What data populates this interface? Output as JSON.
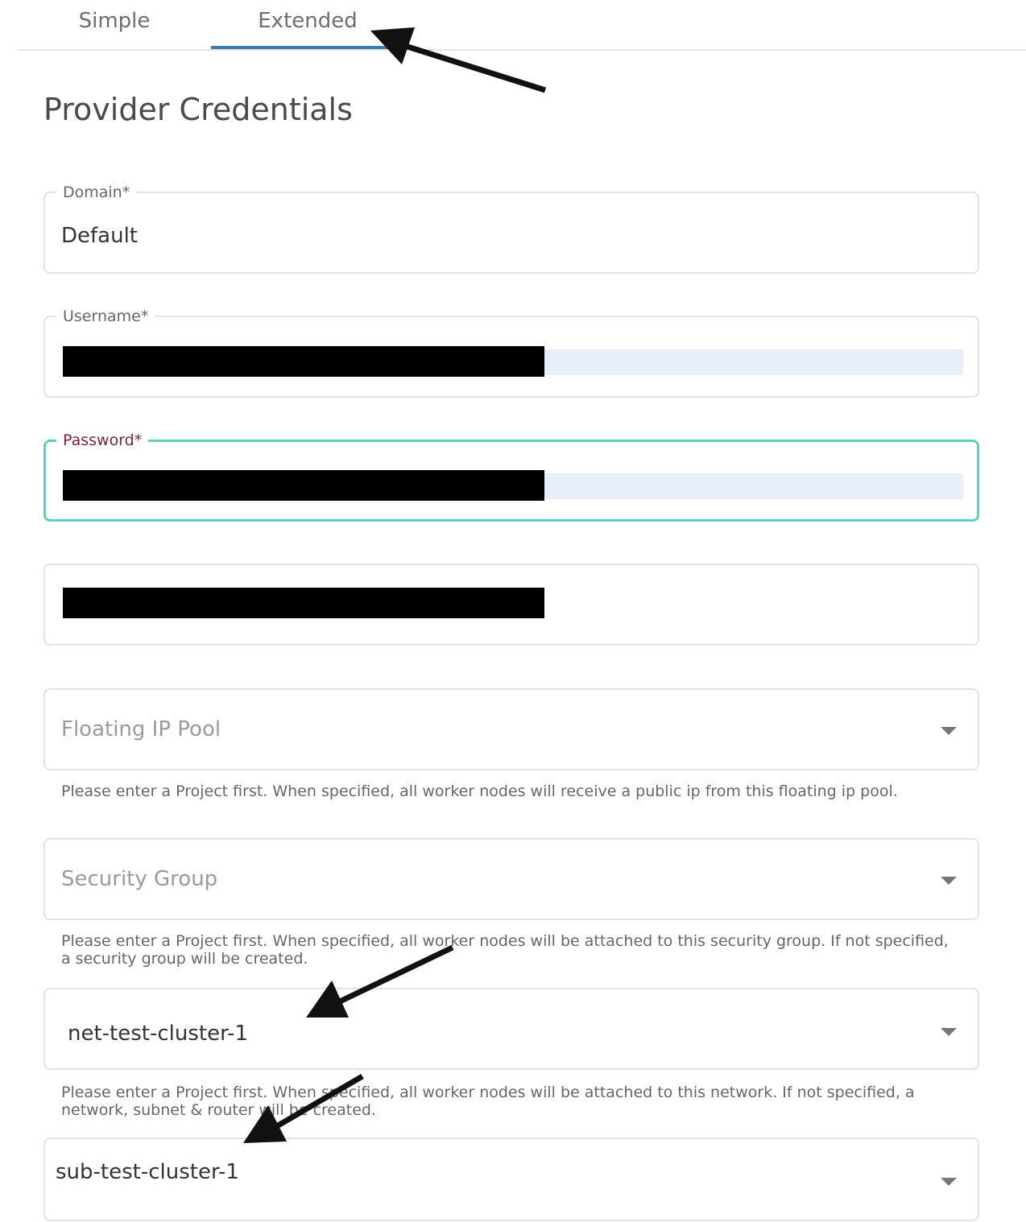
{
  "tabs": [
    {
      "label": "Simple",
      "active": false
    },
    {
      "label": "Extended",
      "active": true
    }
  ],
  "colors": {
    "tab_underline": "#3a7bb0",
    "focus_border": "#5fcfbd",
    "focus_label": "#7a1f3d",
    "autofill": "#e8effb",
    "redaction": "#000000"
  },
  "page_title": "Provider Credentials",
  "domain": {
    "label": "Domain*",
    "value": "Default"
  },
  "username": {
    "label": "Username*"
  },
  "password": {
    "label": "Password*"
  },
  "floating_ip_pool": {
    "placeholder": "Floating IP Pool",
    "help": "Please enter a Project first. When specified, all worker nodes will receive a public ip from this floating ip pool."
  },
  "security_group": {
    "placeholder": "Security Group",
    "help": "Please enter a Project first. When specified, all worker nodes will be attached to this security group. If not specified, a security group will be created."
  },
  "network": {
    "value": "net-test-cluster-1",
    "help": "Please enter a Project first. When specified, all worker nodes will be attached to this network. If not specified, a network, subnet & router will be created."
  },
  "subnet": {
    "value": "sub-test-cluster-1"
  },
  "icons": {
    "dropdown": "caret-down-icon",
    "annotation": "arrow-annotation"
  }
}
